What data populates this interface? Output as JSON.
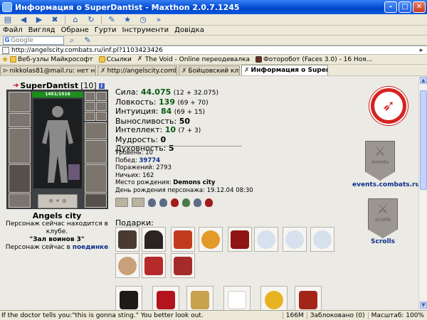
{
  "window": {
    "title": "Информация о SuperDantist - Maxthon 2.0.7.1245",
    "minimize_glyph": "–",
    "maximize_glyph": "□",
    "close_glyph": "✕"
  },
  "menu": [
    "Файл",
    "Вигляд",
    "Обране",
    "Гурти",
    "Інструменти",
    "Довідка"
  ],
  "search": {
    "placeholder": "Google",
    "engine_glyph": "G"
  },
  "address": {
    "url": "http://angelscity.combats.ru/inf.pl?1103423426",
    "go_glyph": "▸"
  },
  "favorites": [
    "Веб-узлы Майкрософт",
    "Ссылки",
    "The Void - Online переодевалка",
    "Фоторобот (Faces 3.0) - 16 Ноя..."
  ],
  "tabs": [
    {
      "label": "nikkolas81@mail.ru: нет не..."
    },
    {
      "label": "http://angelscity.combats..."
    },
    {
      "label": "Бойцовский клуб"
    },
    {
      "label": "Информация о Super..."
    }
  ],
  "character": {
    "arrow": "➔",
    "name": "SuperDantist",
    "level": "[10]",
    "info_glyph": "i",
    "hp": "1451/1516",
    "runes": "⊕ ✶ ⊕"
  },
  "location": {
    "city": "Angels city",
    "line1": "Персонаж сейчас находится в клубе.",
    "room": "\"Зал воинов 3\"",
    "line2_prefix": "Персонаж сейчас в",
    "line2_link": "поединке"
  },
  "stats": {
    "strength": {
      "label": "Сила:",
      "value": "44.075",
      "bonus": "(12 + 32.075)"
    },
    "agility": {
      "label": "Ловкость:",
      "value": "139",
      "bonus": "(69 + 70)"
    },
    "intuition": {
      "label": "Интуиция:",
      "value": "84",
      "bonus": "(69 + 15)"
    },
    "endurance": {
      "label": "Выносливость:",
      "value": "50"
    },
    "intellect": {
      "label": "Интеллект:",
      "value": "10",
      "bonus": "(7 + 3)"
    },
    "wisdom": {
      "label": "Мудрость:",
      "value": "0"
    },
    "spirit": {
      "label": "Духовность:",
      "value": "5"
    }
  },
  "meta": {
    "level": "Уровень: 10",
    "wins_label": "Побед:",
    "wins": "39774",
    "losses": "Поражений: 2793",
    "draws": "Ничьих: 162",
    "birthplace_label": "Место рождения:",
    "birthplace": "Demons city",
    "birthday": "День рождения персонажа: 19.12.04 08:30"
  },
  "gifts": {
    "label": "Подарки:"
  },
  "sidebar": {
    "clan_glyph": "➶",
    "events_shield_text": "events",
    "events_link": "events.combats.ru",
    "scrolls_shield_text": "scrolls",
    "scrolls_link": "Scrolls"
  },
  "status": {
    "message": "If the doctor tells you:\"this is gonna sting.\" You better look out.",
    "memory": "166M",
    "blocked": "Заблоковано (0)",
    "zoom": "Масштаб: 100%"
  },
  "colors": {
    "stat_value": "#0b5b12",
    "link": "#0b2e8b",
    "clan_red": "#d72320",
    "titlebar": "#0a55d8"
  }
}
